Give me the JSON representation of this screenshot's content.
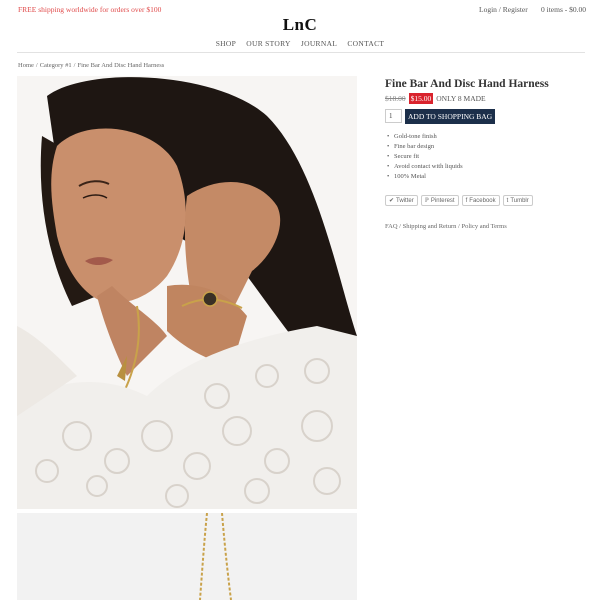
{
  "header": {
    "promo": "FREE shipping worldwide for orders over $100",
    "login": "Login",
    "register": "Register",
    "cart": "0 items - $0.00",
    "logo": "LnC"
  },
  "nav": [
    "SHOP",
    "OUR STORY",
    "JOURNAL",
    "CONTACT"
  ],
  "breadcrumb": [
    "Home",
    "Category #1",
    "Fine Bar And Disc Hand Harness"
  ],
  "product": {
    "title": "Fine Bar And Disc Hand Harness",
    "old_price": "$18.00",
    "new_price": "$15.00",
    "stock": "ONLY 8 MADE",
    "quantity": "1",
    "add_to_bag": "ADD TO SHOPPING BAG",
    "features": [
      "Gold-tone finish",
      "Fine bar design",
      "Secure fit",
      "Avoid contact with liquids",
      "100% Metal"
    ]
  },
  "share": [
    {
      "label": "Twitter",
      "icon": "twitter-icon"
    },
    {
      "label": "Pinterest",
      "icon": "pinterest-icon"
    },
    {
      "label": "Facebook",
      "icon": "facebook-icon"
    },
    {
      "label": "Tumblr",
      "icon": "tumblr-icon"
    }
  ],
  "footer_links": [
    "FAQ",
    "Shipping and Return",
    "Policy and Terms"
  ],
  "colors": {
    "promo": "#e04a4a",
    "sale_badge": "#d9232d",
    "button": "#1c2f4a"
  }
}
